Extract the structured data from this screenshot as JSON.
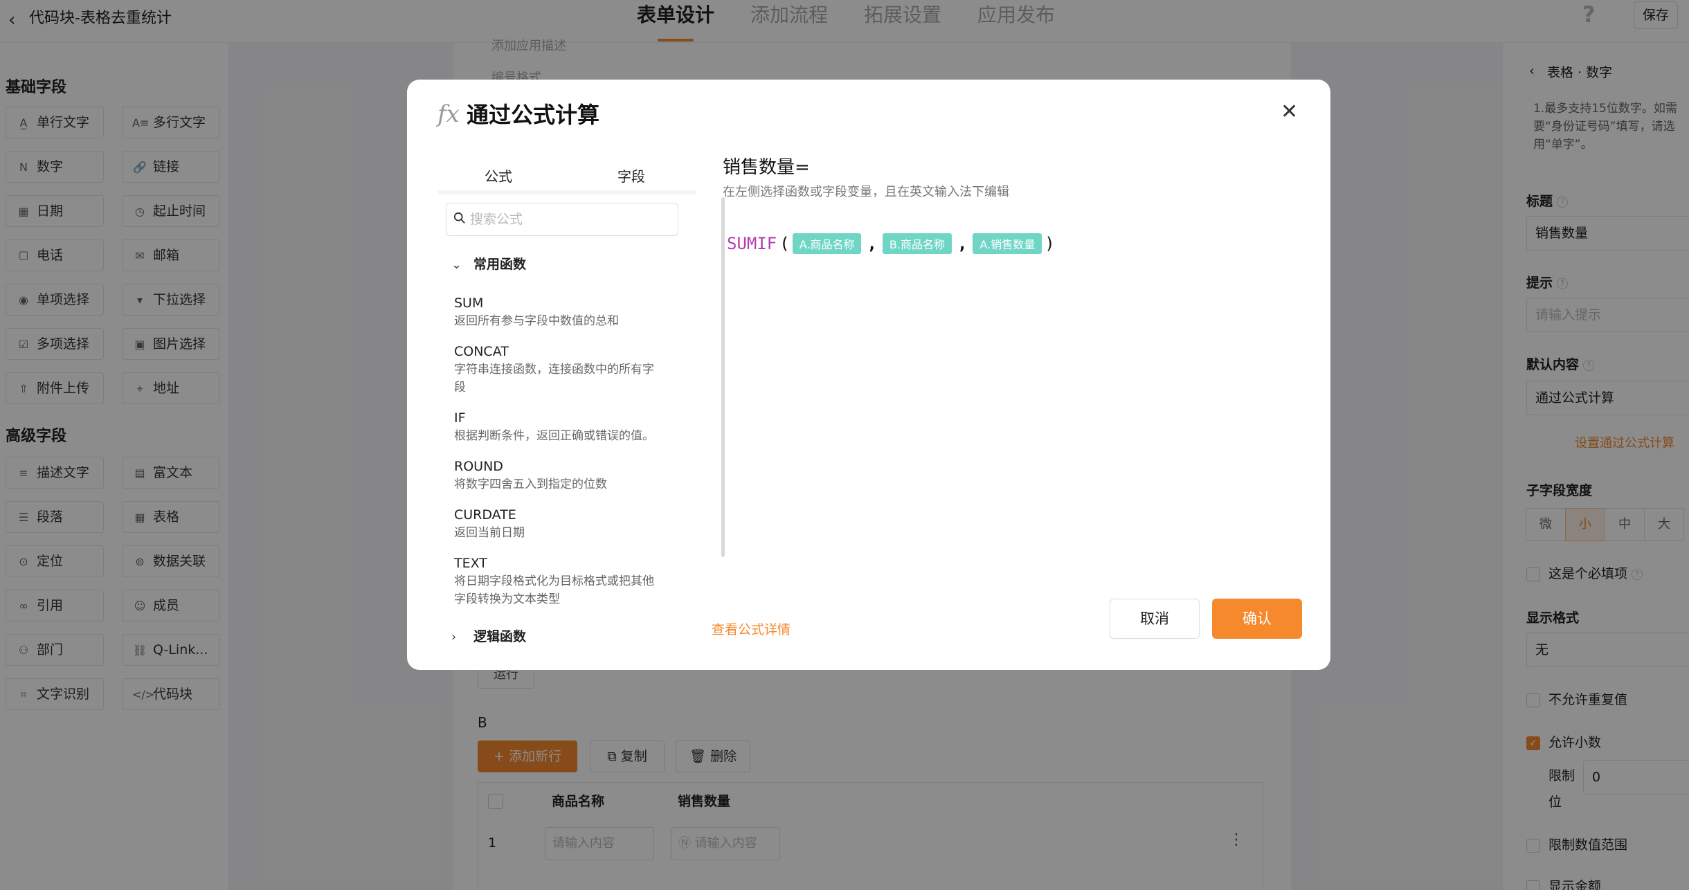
{
  "topbar": {
    "title": "代码块-表格去重统计",
    "tabs": [
      {
        "label": "表单设计",
        "active": true
      },
      {
        "label": "添加流程",
        "active": false
      },
      {
        "label": "拓展设置",
        "active": false
      },
      {
        "label": "应用发布",
        "active": false
      }
    ],
    "help": "?",
    "save_label": "保存"
  },
  "left_panel": {
    "basic_title": "基础字段",
    "basic_fields": [
      {
        "label": "单行文字",
        "icon": "A̲"
      },
      {
        "label": "多行文字",
        "icon": "A≡"
      },
      {
        "label": "数字",
        "icon": "N"
      },
      {
        "label": "链接",
        "icon": "🔗"
      },
      {
        "label": "日期",
        "icon": "▦"
      },
      {
        "label": "起止时间",
        "icon": "◷"
      },
      {
        "label": "电话",
        "icon": "☐"
      },
      {
        "label": "邮箱",
        "icon": "✉"
      },
      {
        "label": "单项选择",
        "icon": "◉"
      },
      {
        "label": "下拉选择",
        "icon": "▾"
      },
      {
        "label": "多项选择",
        "icon": "☑"
      },
      {
        "label": "图片选择",
        "icon": "▣"
      },
      {
        "label": "附件上传",
        "icon": "⇧"
      },
      {
        "label": "地址",
        "icon": "⌖"
      }
    ],
    "advanced_title": "高级字段",
    "advanced_fields": [
      {
        "label": "描述文字",
        "icon": "≡"
      },
      {
        "label": "富文本",
        "icon": "▤"
      },
      {
        "label": "段落",
        "icon": "☰"
      },
      {
        "label": "表格",
        "icon": "▦"
      },
      {
        "label": "定位",
        "icon": "⊙"
      },
      {
        "label": "数据关联",
        "icon": "⊚"
      },
      {
        "label": "引用",
        "icon": "∞"
      },
      {
        "label": "成员",
        "icon": "☺"
      },
      {
        "label": "部门",
        "icon": "⚇"
      },
      {
        "label": "Q-Link...",
        "icon": "⛓"
      },
      {
        "label": "文字识别",
        "icon": "⌗"
      },
      {
        "label": "代码块",
        "icon": "</>"
      }
    ]
  },
  "canvas": {
    "faint_top_1": "添加应用描述",
    "faint_top_2": "编号格式",
    "run_label": "运行",
    "section_b": "B",
    "add_row": "+ 添加新行",
    "copy_label": "复制",
    "delete_label": "删除",
    "table_headers": [
      "商品名称",
      "销售数量"
    ],
    "row_number": "1",
    "cell_placeholder": "请输入内容"
  },
  "right_panel": {
    "title": "表格 · 数字",
    "description": "1.最多支持15位数字。如需要“身份证号码”填写，请选用“单字”。",
    "label_title": "标题",
    "title_value": "销售数量",
    "label_hint": "提示",
    "hint_placeholder": "请输入提示",
    "label_default": "默认内容",
    "default_value": "通过公式计算",
    "formula_link": "设置通过公式计算",
    "label_width": "子字段宽度",
    "width_options": [
      "微",
      "小",
      "中",
      "大"
    ],
    "width_selected": "小",
    "required_label": "这是个必填项",
    "label_format": "显示格式",
    "format_value": "无",
    "no_dup_label": "不允许重复值",
    "decimal_label": "允许小数",
    "limit_label_1": "限制",
    "limit_label_2": "位",
    "limit_value": "0",
    "range_label": "限制数值范围",
    "amount_label": "显示金额"
  },
  "modal": {
    "fx": "fx",
    "title": "通过公式计算",
    "tabs": [
      "公式",
      "字段"
    ],
    "active_tab": "公式",
    "search_placeholder": "搜索公式",
    "category_common": "常用函数",
    "functions": [
      {
        "name": "SUM",
        "desc": "返回所有参与字段中数值的总和"
      },
      {
        "name": "CONCAT",
        "desc": "字符串连接函数，连接函数中的所有字段"
      },
      {
        "name": "IF",
        "desc": "根据判断条件，返回正确或错误的值。"
      },
      {
        "name": "ROUND",
        "desc": "将数字四舍五入到指定的位数"
      },
      {
        "name": "CURDATE",
        "desc": "返回当前日期"
      },
      {
        "name": "TEXT",
        "desc": "将日期字段格式化为目标格式或把其他字段转换为文本类型"
      }
    ],
    "category_logic": "逻辑函数",
    "target_label": "销售数量=",
    "hint": "在左侧选择函数或字段变量，且在英文输入法下编辑",
    "formula": {
      "fn": "SUMIF",
      "open": "(",
      "close": ")",
      "comma": ",",
      "args": [
        "A.商品名称",
        "B.商品名称",
        "A.销售数量"
      ]
    },
    "detail_link": "查看公式详情",
    "cancel": "取消",
    "confirm": "确认"
  },
  "colors": {
    "accent": "#f5892c",
    "chip": "#6fd6c5",
    "function_name": "#b23cb0"
  }
}
